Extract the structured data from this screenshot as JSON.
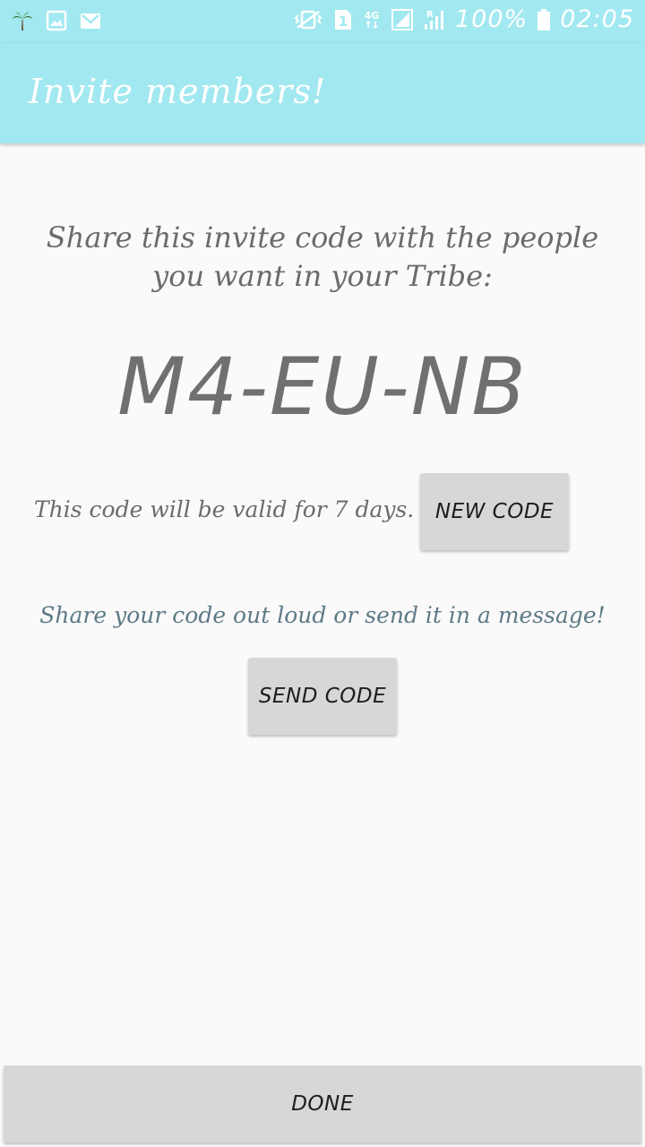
{
  "status_bar": {
    "left_icons": [
      "palm-tree-icon",
      "image-icon",
      "gmail-icon"
    ],
    "right_icons": [
      "vibrate-icon",
      "sim-1-icon",
      "4g-icon",
      "signal-icon",
      "roaming-signal-icon",
      "battery-icon"
    ],
    "network_label": "4G",
    "sim_label": "1",
    "roaming_label": "R",
    "battery_percent": "100%",
    "time": "02:05"
  },
  "app_bar": {
    "title": "Invite members!"
  },
  "content": {
    "instructions": "Share this invite code with the people you want in your Tribe:",
    "invite_code": "M4-EU-NB",
    "validity_text": "This code will be valid for 7 days.",
    "new_code_label": "NEW CODE",
    "share_hint": "Share your code out loud or send it in a message!",
    "send_code_label": "SEND CODE",
    "done_label": "DONE"
  },
  "colors": {
    "app_bar": "#a2e8f0",
    "background": "#fafafa",
    "button": "#d6d7d7",
    "hint_text": "#5e7a86",
    "body_text": "#6b6b6b"
  }
}
